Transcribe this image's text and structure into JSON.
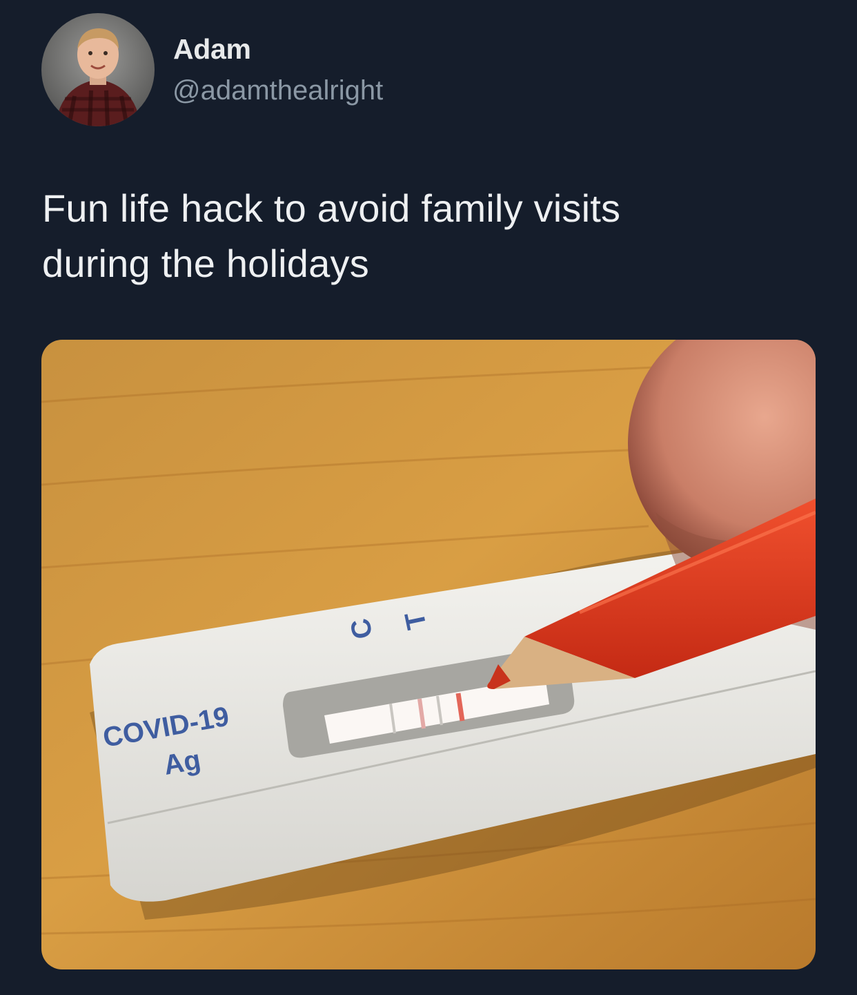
{
  "author": {
    "name": "Adam",
    "handle": "@adamthealright"
  },
  "tweet": {
    "text_line1": "Fun life hack to avoid family visits",
    "text_line2": "during the holidays"
  },
  "media": {
    "device_label_line1": "COVID-19",
    "device_label_line2": "Ag",
    "marker_c": "C",
    "marker_t": "T"
  },
  "colors": {
    "background": "#151d2b",
    "primary_text": "#e7e9ea",
    "secondary_text": "#8b98a5",
    "pencil": "#d8321c"
  }
}
